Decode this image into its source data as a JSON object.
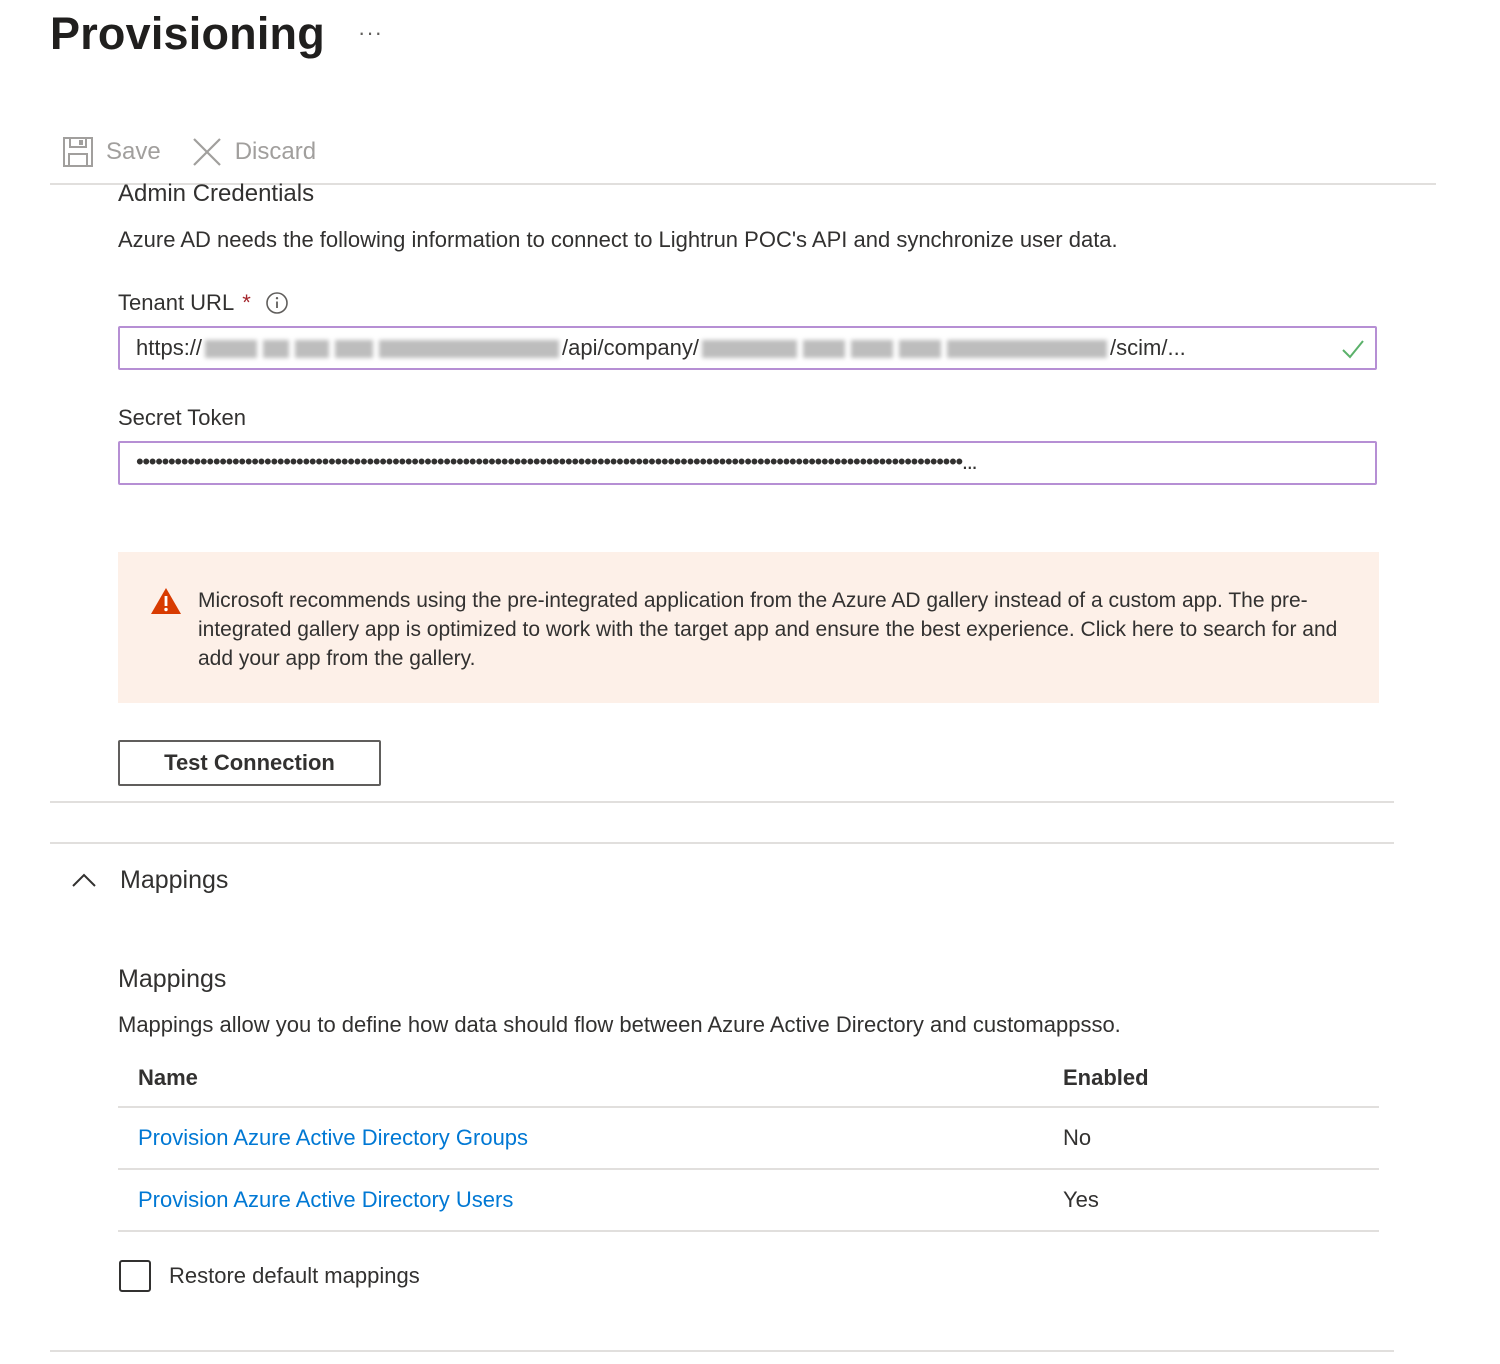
{
  "page": {
    "title": "Provisioning",
    "more_label": "···"
  },
  "toolbar": {
    "save_label": "Save",
    "discard_label": "Discard",
    "save_icon": "save-icon",
    "discard_icon": "close-icon"
  },
  "admin_credentials": {
    "heading": "Admin Credentials",
    "description": "Azure AD needs the following information to connect to Lightrun POC's API and synchronize user data.",
    "tenant_url": {
      "label": "Tenant URL",
      "required_mark": "*",
      "value_prefix": "https://",
      "value_mid": "/api/company/",
      "value_suffix": "/scim/...",
      "validated": true
    },
    "secret_token": {
      "label": "Secret Token",
      "masked_value": "•••••••••••••••••••••••••••••••••••••••••••••••••••••••••••••••••••••••••••••••••••••••••••••••••••••••••••••••••••••••••••••••••..."
    },
    "warning_text": "Microsoft recommends using the pre-integrated application from the Azure AD gallery instead of a custom app. The pre-integrated gallery app is optimized to work with the target app and ensure the best experience. Click here to search for and add your app from the gallery.",
    "test_connection_label": "Test Connection"
  },
  "mappings_section": {
    "collapse_label": "Mappings",
    "heading": "Mappings",
    "description": "Mappings allow you to define how data should flow between Azure Active Directory and customappsso.",
    "columns": {
      "name": "Name",
      "enabled": "Enabled"
    },
    "rows": [
      {
        "name": "Provision Azure Active Directory Groups",
        "enabled": "No"
      },
      {
        "name": "Provision Azure Active Directory Users",
        "enabled": "Yes"
      }
    ],
    "restore_label": "Restore default mappings"
  },
  "colors": {
    "accent_link": "#0078d4",
    "input_border": "#b68fd4",
    "warning_bg": "#fdf0e8",
    "warning_icon": "#d83b01",
    "success_check": "#107c10",
    "required": "#a4262c"
  }
}
